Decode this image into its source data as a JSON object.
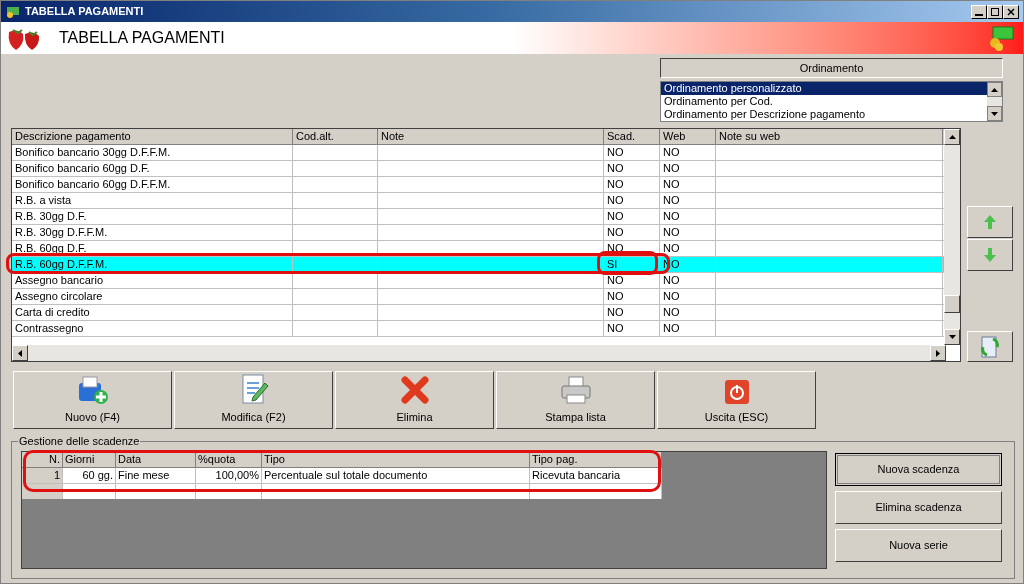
{
  "window": {
    "title": "TABELLA PAGAMENTI"
  },
  "header": {
    "title": "TABELLA PAGAMENTI"
  },
  "ordering": {
    "title": "Ordinamento",
    "options": [
      {
        "label": "Ordinamento personalizzato",
        "selected": true
      },
      {
        "label": "Ordinamento per Cod.",
        "selected": false
      },
      {
        "label": "Ordinamento per Descrizione pagamento",
        "selected": false
      }
    ]
  },
  "table": {
    "columns": [
      "Descrizione pagamento",
      "Cod.alt.",
      "Note",
      "Scad.",
      "Web",
      "Note su web"
    ],
    "rows": [
      {
        "cells": [
          "Bonifico bancario 30gg D.F.F.M.",
          "",
          "",
          "NO",
          "NO",
          ""
        ],
        "selected": false
      },
      {
        "cells": [
          "Bonifico bancario 60gg D.F.",
          "",
          "",
          "NO",
          "NO",
          ""
        ],
        "selected": false
      },
      {
        "cells": [
          "Bonifico bancario 60gg D.F.F.M.",
          "",
          "",
          "NO",
          "NO",
          ""
        ],
        "selected": false
      },
      {
        "cells": [
          "R.B. a vista",
          "",
          "",
          "NO",
          "NO",
          ""
        ],
        "selected": false
      },
      {
        "cells": [
          "R.B. 30gg D.F.",
          "",
          "",
          "NO",
          "NO",
          ""
        ],
        "selected": false
      },
      {
        "cells": [
          "R.B. 30gg D.F.F.M.",
          "",
          "",
          "NO",
          "NO",
          ""
        ],
        "selected": false
      },
      {
        "cells": [
          "R.B. 60gg D.F.",
          "",
          "",
          "NO",
          "NO",
          ""
        ],
        "selected": false
      },
      {
        "cells": [
          "R.B. 60gg D.F.F.M.",
          "",
          "",
          "SI",
          "NO",
          ""
        ],
        "selected": true
      },
      {
        "cells": [
          "Assegno bancario",
          "",
          "",
          "NO",
          "NO",
          ""
        ],
        "selected": false
      },
      {
        "cells": [
          "Assegno circolare",
          "",
          "",
          "NO",
          "NO",
          ""
        ],
        "selected": false
      },
      {
        "cells": [
          "Carta di credito",
          "",
          "",
          "NO",
          "NO",
          ""
        ],
        "selected": false
      },
      {
        "cells": [
          "Contrassegno",
          "",
          "",
          "NO",
          "NO",
          ""
        ],
        "selected": false
      }
    ]
  },
  "toolbar": [
    {
      "label": "Nuovo (F4)",
      "kind": "new"
    },
    {
      "label": "Modifica (F2)",
      "kind": "edit"
    },
    {
      "label": "Elimina",
      "kind": "delete"
    },
    {
      "label": "Stampa lista",
      "kind": "print"
    },
    {
      "label": "Uscita (ESC)",
      "kind": "exit"
    }
  ],
  "deadlines": {
    "title": "Gestione delle scadenze",
    "columns": [
      "N.",
      "Giorni",
      "Data",
      "%quota",
      "Tipo",
      "Tipo pag."
    ],
    "rows": [
      {
        "cells": [
          "1",
          "60 gg.",
          "Fine mese",
          "100,00%",
          "Percentuale sul totale documento",
          "Ricevuta bancaria"
        ]
      }
    ],
    "buttons": [
      {
        "label": "Nuova scadenza",
        "default": true
      },
      {
        "label": "Elimina scadenza",
        "default": false
      },
      {
        "label": "Nuova serie",
        "default": false
      }
    ]
  }
}
